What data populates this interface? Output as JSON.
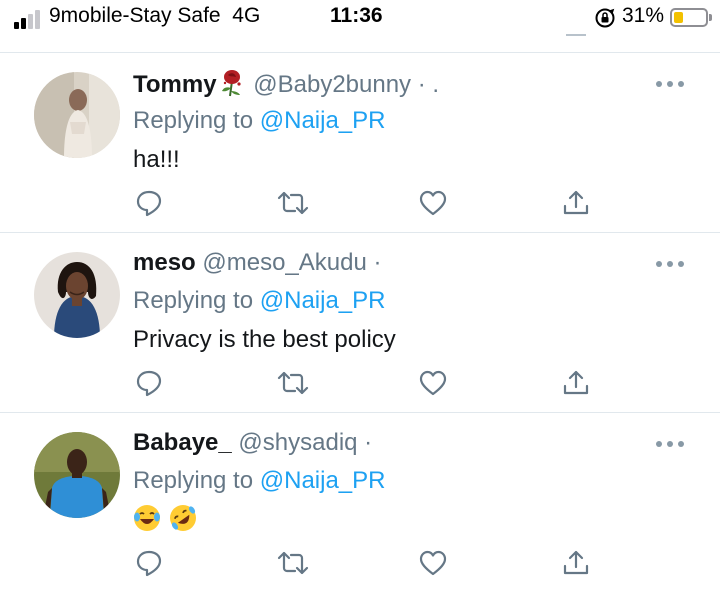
{
  "status_bar": {
    "carrier": "9mobile-Stay Safe",
    "network": "4G",
    "time": "11:36",
    "battery_percent": "31%",
    "battery_level": 0.31,
    "battery_color": "#f2c100"
  },
  "colors": {
    "accent": "#1da1f2",
    "secondary_text": "#657786",
    "divider": "#e1e8ed"
  },
  "replies": [
    {
      "name": "Tommy",
      "name_emoji": "rose-icon",
      "handle": "@Baby2bunny",
      "suffix": "· .",
      "replying_label": "Replying to",
      "replying_to": "@Naija_PR",
      "text": "ha!!!",
      "emojis": []
    },
    {
      "name": "meso",
      "handle": "@meso_Akudu",
      "suffix": "·",
      "replying_label": "Replying to",
      "replying_to": "@Naija_PR",
      "text": "Privacy is the best policy",
      "emojis": []
    },
    {
      "name": "Babaye_",
      "handle": "@shysadiq",
      "suffix": "·",
      "replying_label": "Replying to",
      "replying_to": "@Naija_PR",
      "text": "",
      "emojis": [
        "face-with-tears-of-joy-icon",
        "rolling-on-floor-laughing-icon"
      ]
    }
  ],
  "actions": [
    "reply-icon",
    "retweet-icon",
    "like-icon",
    "share-icon"
  ]
}
